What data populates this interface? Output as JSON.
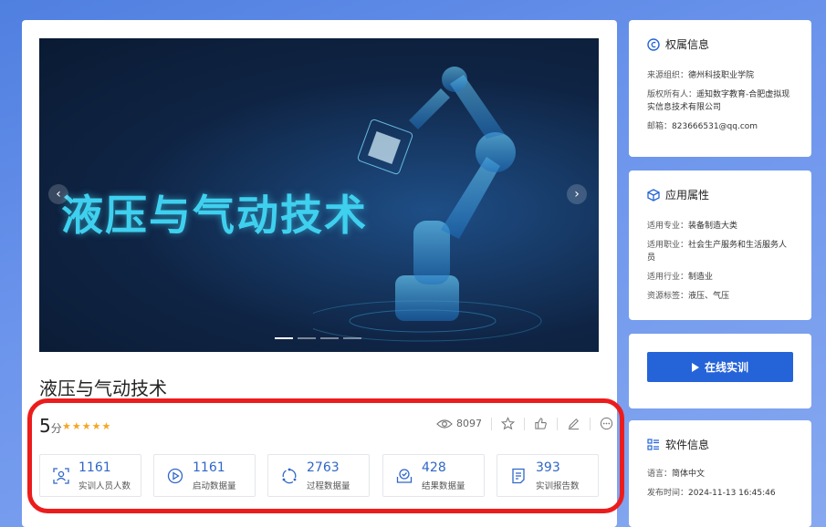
{
  "banner": {
    "title": "液压与气动技术"
  },
  "course": {
    "title": "液压与气动技术",
    "score": "5",
    "score_unit": "分",
    "stars": "★★★★★"
  },
  "actions": {
    "views": "8097"
  },
  "stats": [
    {
      "value": "1161",
      "label": "实训人员人数",
      "icon": "person-scan-icon"
    },
    {
      "value": "1161",
      "label": "启动数据量",
      "icon": "play-circle-icon"
    },
    {
      "value": "2763",
      "label": "过程数据量",
      "icon": "cycle-icon"
    },
    {
      "value": "428",
      "label": "结果数据量",
      "icon": "tray-check-icon"
    },
    {
      "value": "393",
      "label": "实训报告数",
      "icon": "report-doc-icon"
    }
  ],
  "ownership": {
    "title": "权属信息",
    "org_label": "来源组织：",
    "org_value": "德州科技职业学院",
    "owner_label": "版权所有人：",
    "owner_value": "遥知数字教育-合肥虚拟现实信息技术有限公司",
    "email_label": "邮箱：",
    "email_value": "823666531@qq.com"
  },
  "application": {
    "title": "应用属性",
    "major_label": "适用专业：",
    "major_value": "装备制造大类",
    "job_label": "适用职业：",
    "job_value": "社会生产服务和生活服务人员",
    "industry_label": "适用行业：",
    "industry_value": "制造业",
    "tags_label": "资源标签：",
    "tags_value": "液压、气压"
  },
  "online": {
    "button_label": "在线实训"
  },
  "software": {
    "title": "软件信息",
    "lang_label": "语言：",
    "lang_value": "简体中文",
    "date_label": "发布时间：",
    "date_value": "2024-11-13 16:45:46"
  },
  "colors": {
    "accent": "#2563d8",
    "highlight": "#ec1c1c",
    "star": "#f5a623"
  }
}
